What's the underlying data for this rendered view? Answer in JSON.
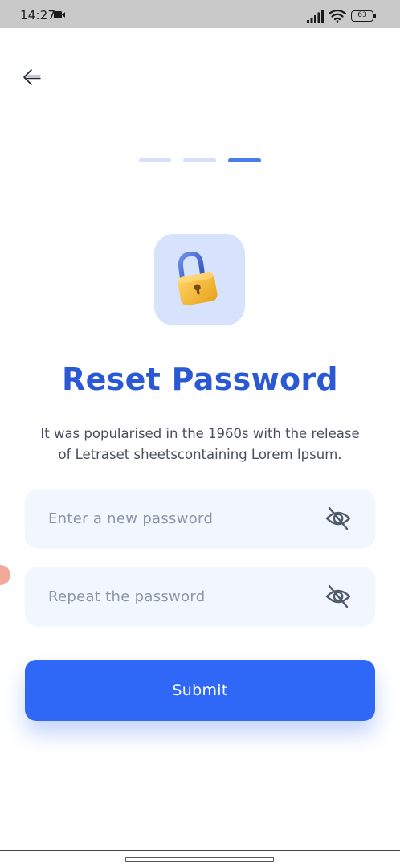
{
  "status_bar": {
    "time": "14:27",
    "battery_level": "63",
    "icons": [
      "video-camera-icon",
      "signal-icon",
      "wifi-icon",
      "battery-icon"
    ]
  },
  "header": {
    "back_icon": "arrow-left-icon"
  },
  "steps": {
    "total": 3,
    "active": 3,
    "colors": {
      "inactive": "#d6e0fb",
      "active": "#4c7bf0"
    }
  },
  "illustration": {
    "icon": "padlock-icon",
    "tile_color": "#d7e2fd"
  },
  "main": {
    "title": "Reset Password",
    "description_line1": "It was popularised in the 1960s with the release",
    "description_line2": "of Letraset sheetscontaining Lorem Ipsum."
  },
  "form": {
    "new_password": {
      "value": "",
      "placeholder": "Enter a new password",
      "toggle_icon": "eye-off-icon"
    },
    "repeat_password": {
      "value": "",
      "placeholder": "Repeat the password",
      "toggle_icon": "eye-off-icon"
    },
    "submit_label": "Submit"
  },
  "colors": {
    "accent": "#2f67f6",
    "title": "#2b59d3",
    "field_bg": "#f1f6ff"
  }
}
